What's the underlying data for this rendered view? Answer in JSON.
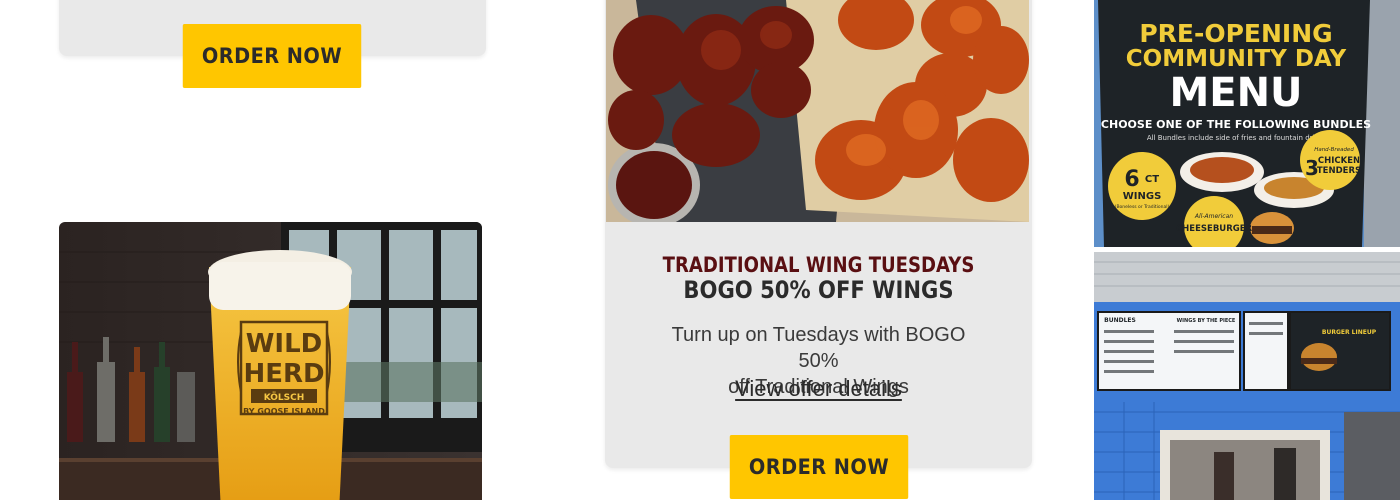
{
  "left_card": {
    "order_button": "ORDER NOW"
  },
  "beer_image": {
    "glass_brand_line1": "WILD",
    "glass_brand_line2": "HERD",
    "glass_style": "KÖLSCH",
    "glass_maker": "BY GOOSE ISLAND"
  },
  "promo_card": {
    "eyebrow": "TRADITIONAL WING TUESDAYS",
    "title": "BOGO 50% OFF WINGS",
    "description_line1": "Turn up on Tuesdays with BOGO 50%",
    "description_line2": "off Traditional Wings",
    "link": "View offer details",
    "order_button": "ORDER NOW"
  },
  "menu_photo": {
    "heading_line1": "PRE-OPENING",
    "heading_line2": "COMMUNITY DAY",
    "heading_line3": "MENU",
    "subheading": "CHOOSE ONE OF THE FOLLOWING BUNDLES",
    "note": "All Bundles include side of fries and fountain drink.",
    "bundle1_count": "6",
    "bundle1_unit": "CT",
    "bundle1_item": "WINGS",
    "bundle1_detail": "(Boneless or Traditional)",
    "bundle2_top": "All-American",
    "bundle2_item": "CHEESEBURGER",
    "bundle3_top": "Hand-Breaded",
    "bundle3_count": "3",
    "bundle3_item1": "CHICKEN",
    "bundle3_item2": "TENDERS"
  },
  "store_photo": {
    "board1": "BUNDLES",
    "board2": "WINGS BY THE PIECE",
    "board3": "BURGER LINEUP"
  },
  "colors": {
    "accent_yellow": "#ffc600",
    "card_gray": "#e9e9e9",
    "eyebrow_maroon": "#5a0f12"
  }
}
